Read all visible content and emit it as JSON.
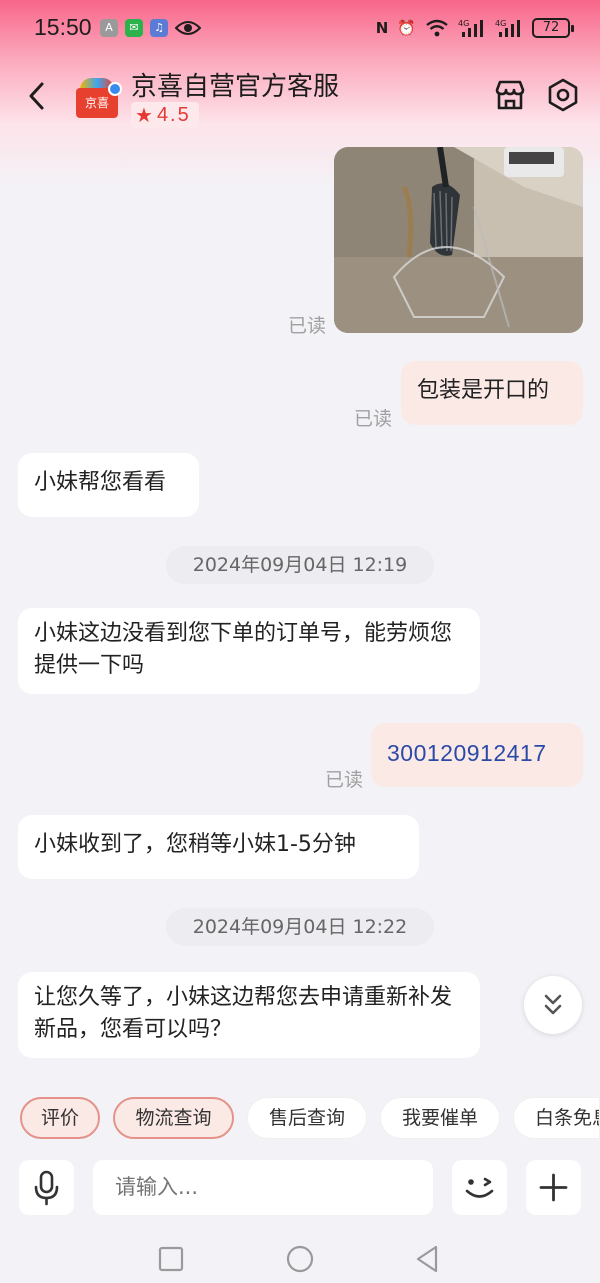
{
  "status_bar": {
    "time": "15:50",
    "battery": "72"
  },
  "header": {
    "title": "京喜自营官方客服",
    "logo_text": "京喜",
    "rating": "4.5"
  },
  "messages": {
    "read_label": "已读",
    "msg_packaging": "包装是开口的",
    "msg_check": "小妹帮您看看",
    "timestamp1": "2024年09月04日  12:19",
    "msg_no_order": "小妹这边没看到您下单的订单号，能劳烦您提供一下吗",
    "order_number": "300120912417",
    "msg_received": "小妹收到了，您稍等小妹1-5分钟",
    "timestamp2": "2024年09月04日  12:22",
    "msg_reship": "让您久等了，小妹这边帮您去申请重新补发新品，您看可以吗？"
  },
  "quick_actions": {
    "items": [
      "评价",
      "物流查询",
      "售后查询",
      "我要催单",
      "白条免息"
    ]
  },
  "input": {
    "placeholder": "请输入..."
  },
  "colors": {
    "accent": "#e53935",
    "outgoing_bubble": "#fbe9e6",
    "order_link": "#2b4aa8"
  }
}
